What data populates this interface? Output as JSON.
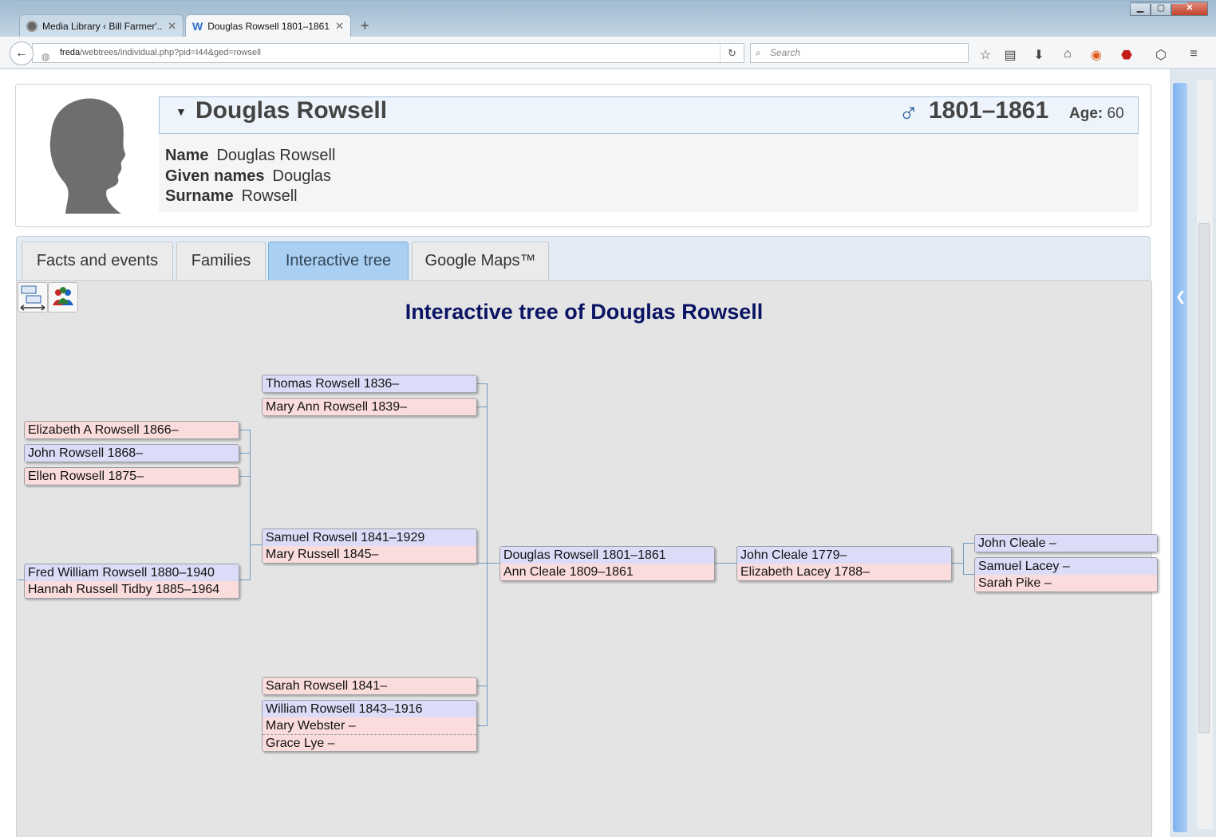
{
  "browser": {
    "tabs": [
      {
        "title": "Media Library ‹ Bill Farmer'...",
        "active": false
      },
      {
        "title": "Douglas Rowsell 1801–1861...",
        "active": true
      }
    ],
    "url_host": "freda",
    "url_path": "/webtrees/individual.php?pid=I44&ged=rowsell",
    "search_placeholder": "Search"
  },
  "individual": {
    "name": "Douglas Rowsell",
    "lifespan": "1801–1861",
    "age_label": "Age:",
    "age_value": "60",
    "sex_symbol": "♂",
    "details": [
      {
        "label": "Name",
        "value": "Douglas Rowsell"
      },
      {
        "label": "Given names",
        "value": "Douglas"
      },
      {
        "label": "Surname",
        "value": "Rowsell"
      }
    ]
  },
  "tabs": [
    {
      "label": "Facts and events"
    },
    {
      "label": "Families"
    },
    {
      "label": "Interactive tree"
    },
    {
      "label": "Google Maps™"
    }
  ],
  "tree": {
    "heading": "Interactive tree of Douglas Rowsell",
    "grandchildren": {
      "elizabeth": "Elizabeth A Rowsell 1866–",
      "john": "John Rowsell 1868–",
      "ellen": "Ellen Rowsell 1875–",
      "fred": "Fred William Rowsell 1880–1940",
      "hannah": "Hannah Russell Tidby 1885–1964"
    },
    "children": {
      "thomas": "Thomas Rowsell 1836–",
      "maryann": "Mary Ann Rowsell 1839–",
      "samuel": "Samuel Rowsell 1841–1929",
      "maryrussell": "Mary Russell 1845–",
      "sarah": "Sarah Rowsell 1841–",
      "william": "William Rowsell 1843–1916",
      "marywebster": "Mary Webster –",
      "grace": "Grace Lye –"
    },
    "root": {
      "douglas": "Douglas Rowsell 1801–1861",
      "ann": "Ann Cleale 1809–1861"
    },
    "parents": {
      "johncleale": "John Cleale 1779–",
      "elizabethlacey": "Elizabeth Lacey 1788–"
    },
    "grandparents": {
      "johncleale2": "John Cleale –",
      "samuellacey": "Samuel Lacey –",
      "sarahpike": "Sarah Pike –"
    }
  }
}
